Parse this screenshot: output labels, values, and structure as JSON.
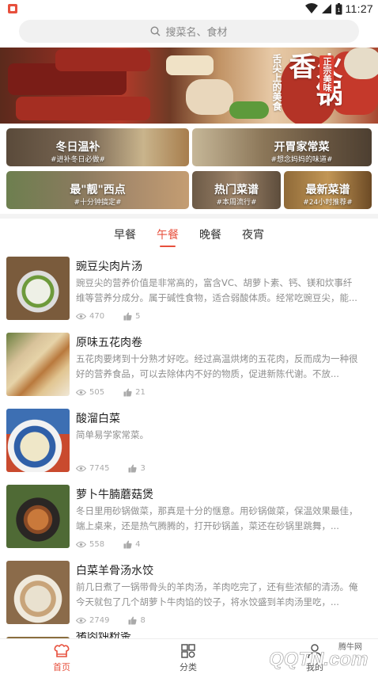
{
  "status_bar": {
    "time": "11:27",
    "battery": "1"
  },
  "search": {
    "placeholder": "搜菜名、食材"
  },
  "banner": {
    "title": "火锅香",
    "tag": "正宗美味",
    "slogan": "舌尖上的美食"
  },
  "categories": [
    {
      "title": "冬日温补",
      "subtitle": "#进补冬日必做#"
    },
    {
      "title": "开胃家常菜",
      "subtitle": "#想念妈妈的味道#"
    },
    {
      "title": "最\"靓\"西点",
      "subtitle": "#十分钟搞定#"
    },
    {
      "title": "热门菜谱",
      "subtitle": "#本周流行#"
    },
    {
      "title": "最新菜谱",
      "subtitle": "#24小时推荐#"
    }
  ],
  "meal_tabs": [
    {
      "label": "早餐",
      "active": false
    },
    {
      "label": "午餐",
      "active": true
    },
    {
      "label": "晚餐",
      "active": false
    },
    {
      "label": "夜宵",
      "active": false
    }
  ],
  "recipes": [
    {
      "name": "豌豆尖肉片汤",
      "desc": "豌豆尖的营养价值是非常高的，富含VC、胡萝卜素、钙、镁和炊事纤维等营养分成分。属于碱性食物，适合弱酸体质。经常吃豌豆尖，能...",
      "views": "470",
      "likes": "5"
    },
    {
      "name": "原味五花肉卷",
      "desc": "五花肉要烤到十分熟才好吃。经过高温烘烤的五花肉，反而成为一种很好的营养食品，可以去除体内不好的物质，促进新陈代谢。不放...",
      "views": "505",
      "likes": "21"
    },
    {
      "name": "酸溜白菜",
      "desc": "简单易学家常菜。",
      "views": "7745",
      "likes": "3"
    },
    {
      "name": "萝卜牛腩蘑菇煲",
      "desc": "冬日里用砂锅做菜，那真是十分的惬意。用砂锅做菜，保温效果最佳，端上桌来，还是热气腾腾的，打开砂锅盖，菜还在砂锅里跳舞，...",
      "views": "558",
      "likes": "4"
    },
    {
      "name": "白菜羊骨汤水饺",
      "desc": "前几日煮了一锅带骨头的羊肉汤，羊肉吃完了，还有些浓郁的清汤。俺今天就包了几个胡萝卜牛肉馅的饺子，将水饺盛到羊肉汤里吃，...",
      "views": "2749",
      "likes": "8"
    }
  ],
  "partial_item": {
    "name": "猪肉炖粉条"
  },
  "bottom_nav": [
    {
      "label": "首页",
      "active": true
    },
    {
      "label": "分类",
      "active": false
    },
    {
      "label": "我的",
      "active": false
    }
  ],
  "watermark": {
    "brand": "QQTN.com",
    "tag": "腾牛网"
  },
  "colors": {
    "accent": "#e7503d",
    "text": "#222222",
    "muted": "#8e8e8e"
  }
}
